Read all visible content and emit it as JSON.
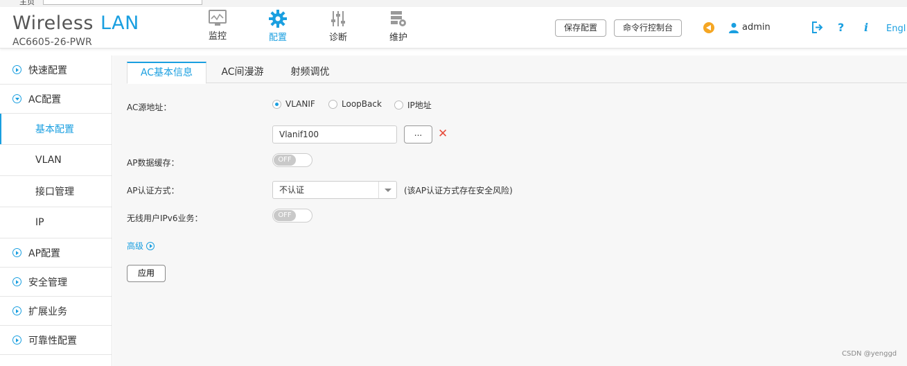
{
  "browser": {
    "prefix": "主页",
    "url": ""
  },
  "header": {
    "brand_main": "Wireless",
    "brand_accent": "LAN",
    "model": "AC6605-26-PWR",
    "nav": [
      {
        "label": "监控",
        "icon": "monitor-icon"
      },
      {
        "label": "配置",
        "icon": "gear-icon"
      },
      {
        "label": "诊断",
        "icon": "sliders-icon"
      },
      {
        "label": "维护",
        "icon": "server-gear-icon"
      }
    ],
    "save_label": "保存配置",
    "cli_label": "命令行控制台",
    "user": "admin",
    "logout_icon": "logout-icon",
    "help_glyph": "?",
    "info_glyph": "i",
    "language": "Engl"
  },
  "sidebar": {
    "items": [
      {
        "label": "快速配置"
      },
      {
        "label": "AC配置"
      },
      {
        "label": "基本配置"
      },
      {
        "label": "VLAN"
      },
      {
        "label": "接口管理"
      },
      {
        "label": "IP"
      },
      {
        "label": "AP配置"
      },
      {
        "label": "安全管理"
      },
      {
        "label": "扩展业务"
      },
      {
        "label": "可靠性配置"
      }
    ]
  },
  "tabs": [
    {
      "label": "AC基本信息"
    },
    {
      "label": "AC间漫游"
    },
    {
      "label": "射频调优"
    }
  ],
  "form": {
    "source_label": "AC源地址：",
    "radio_options": [
      "VLANIF",
      "LoopBack",
      "IP地址"
    ],
    "selected_radio": "VLANIF",
    "source_value": "Vlanif100",
    "browse_label": "...",
    "clear_glyph": "✕",
    "cache_label": "AP数据缓存：",
    "cache_state": "OFF",
    "auth_label": "AP认证方式：",
    "auth_value": "不认证",
    "auth_hint": "(该AP认证方式存在安全风险)",
    "ipv6_label": "无线用户IPv6业务：",
    "ipv6_state": "OFF",
    "advanced_label": "高级",
    "apply_label": "应用"
  },
  "watermark": "CSDN @yenggd",
  "colors": {
    "accent": "#1a9fe0",
    "warning": "#f5a623",
    "danger": "#e74c3c"
  }
}
